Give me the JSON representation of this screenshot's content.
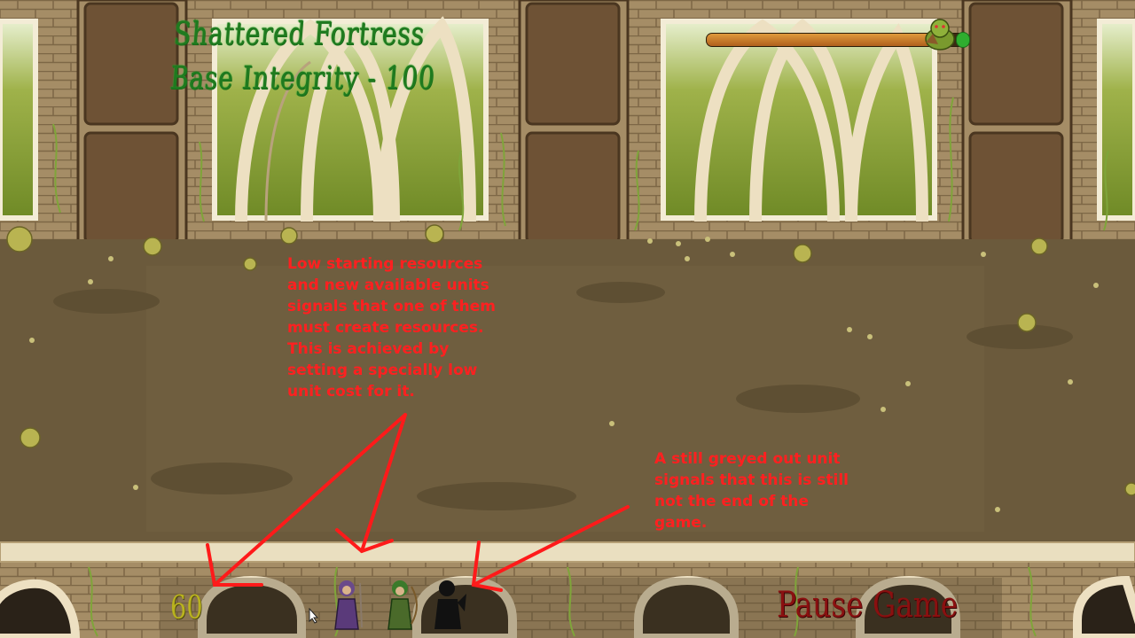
{
  "hud": {
    "level_name": "Shattered Fortress",
    "base_integrity_text": "Base Integrity - 100",
    "enemy_health_fraction": 0.87
  },
  "annotations": {
    "resources_note": "Low starting resources\nand new available units\nsignals that one of them\nmust create resources.\nThis is achieved by\nsetting a specially low\nunit cost for it.",
    "greyed_unit_note": "A still greyed out unit\nsignals that this is still\nnot the end of the\ngame."
  },
  "bottom_bar": {
    "resources": "60",
    "pause_label": "Pause Game",
    "units": [
      {
        "name": "purple-mage-unit",
        "state": "available"
      },
      {
        "name": "green-archer-unit",
        "state": "available"
      },
      {
        "name": "locked-unit",
        "state": "greyed-out"
      }
    ]
  },
  "colors": {
    "hud_text": "#1f7a1f",
    "annotation": "#ff2020",
    "resources": "#b9b31e",
    "pause": "#8a1010"
  }
}
